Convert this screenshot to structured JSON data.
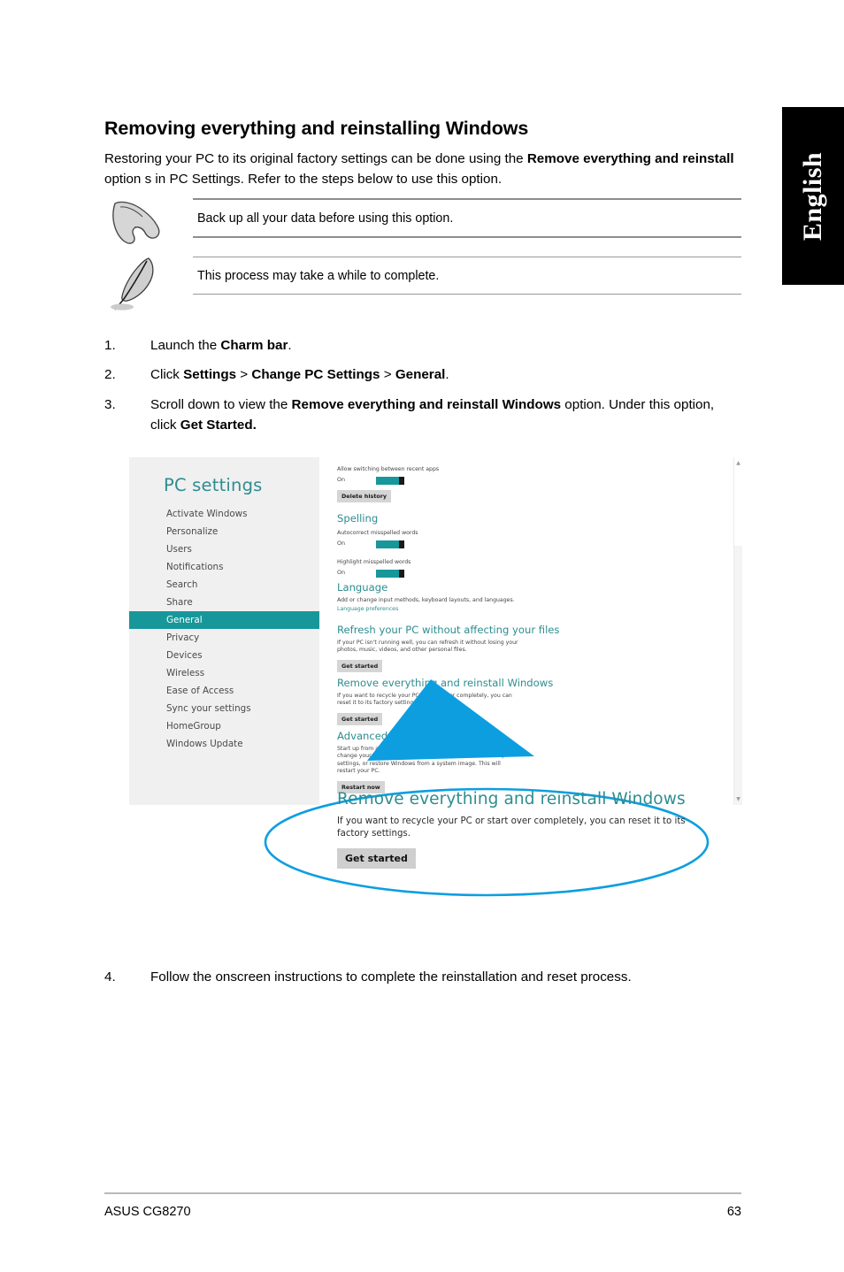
{
  "language_tab": {
    "label": "English"
  },
  "heading": "Removing everything and reinstalling Windows",
  "intro": {
    "part1": "Restoring your PC to its original factory settings can be done using the ",
    "bold1": "Remove everything and reinstall",
    "part2": " option s in PC Settings. Refer to the steps below to use this option."
  },
  "notes": [
    {
      "icon": "important-hand-icon",
      "text": "Back up all your data before using this option."
    },
    {
      "icon": "note-feather-icon",
      "text": "This process may take a while to complete."
    }
  ],
  "steps": [
    {
      "num": "1.",
      "part1": "Launch the ",
      "bold1": "Charm bar",
      "part2": "."
    },
    {
      "num": "2.",
      "part1": "Click ",
      "bold1": "Settings",
      "part2": " > ",
      "bold2": "Change PC Settings",
      "part3": " > ",
      "bold3": "General",
      "part4": "."
    },
    {
      "num": "3.",
      "part1": "Scroll down to view the ",
      "bold1": "Remove everything and reinstall Windows",
      "part2": " option. Under this option, click ",
      "bold2": "Get Started."
    },
    {
      "num": "4.",
      "part1": "Follow the onscreen instructions to complete the reinstallation and reset process."
    }
  ],
  "screenshot": {
    "title": "PC settings",
    "nav_items": [
      "Activate Windows",
      "Personalize",
      "Users",
      "Notifications",
      "Search",
      "Share",
      "General",
      "Privacy",
      "Devices",
      "Wireless",
      "Ease of Access",
      "Sync your settings",
      "HomeGroup",
      "Windows Update"
    ],
    "active_nav": "General",
    "accent_teal": "#17979a",
    "heading_teal": "#2e8d90",
    "content": {
      "app_switching_label": "Allow switching between recent apps",
      "app_switching_state": "On",
      "delete_history_button": "Delete history",
      "spelling_heading": "Spelling",
      "autocorrect_label": "Autocorrect misspelled words",
      "autocorrect_state": "On",
      "highlight_label": "Highlight misspelled words",
      "highlight_state": "On",
      "language_heading": "Language",
      "language_desc": "Add or change input methods, keyboard layouts, and languages.",
      "language_link": "Language preferences",
      "refresh_heading": "Refresh your PC without affecting your files",
      "refresh_desc": "If your PC isn't running well, you can refresh it without losing your photos, music, videos, and other personal files.",
      "refresh_button": "Get started",
      "remove_heading": "Remove everything and reinstall Windows",
      "remove_desc": "If you want to recycle your PC or start over completely, you can reset it to its factory settings.",
      "remove_button": "Get started",
      "advanced_heading": "Advanced startup",
      "advanced_desc": "Start up from a device or disc (such as a USB drive or DVD), change your PC's firmware settings, change Windows startup settings, or restore Windows from a system image. This will restart your PC.",
      "advanced_button": "Restart now"
    }
  },
  "callout": {
    "accent_blue": "#0d9ee0",
    "heading": "Remove everything and reinstall Windows",
    "description": "If you want to recycle your PC or start over completely, you can reset it to its factory settings.",
    "button": "Get started"
  },
  "footer": {
    "left": "ASUS CG8270",
    "page_number": "63"
  }
}
